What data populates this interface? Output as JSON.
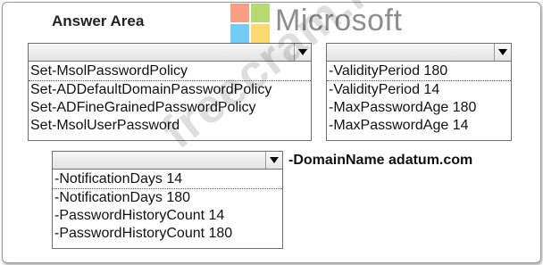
{
  "answer_area": {
    "title": "Answer Area"
  },
  "logo": {
    "text": "Microsoft",
    "colors": [
      "#f25022",
      "#7fba00",
      "#00a4ef",
      "#ffb900"
    ]
  },
  "watermark": {
    "text": "freecram.net"
  },
  "dropdown1": {
    "selected": "",
    "options": [
      "Set-MsolPasswordPolicy",
      "Set-ADDefaultDomainPasswordPolicy",
      "Set-ADFineGrainedPasswordPolicy",
      "Set-MsolUserPassword"
    ]
  },
  "dropdown2": {
    "selected": "",
    "options": [
      "-ValidityPeriod 180",
      "-ValidityPeriod 14",
      "-MaxPasswordAge 180",
      "-MaxPasswordAge 14"
    ]
  },
  "dropdown3": {
    "selected": "",
    "options": [
      "-NotificationDays 14",
      "-NotificationDays 180",
      "-PasswordHistoryCount 14",
      "-PasswordHistoryCount 180"
    ]
  },
  "static_param": {
    "text": "-DomainName adatum.com"
  }
}
